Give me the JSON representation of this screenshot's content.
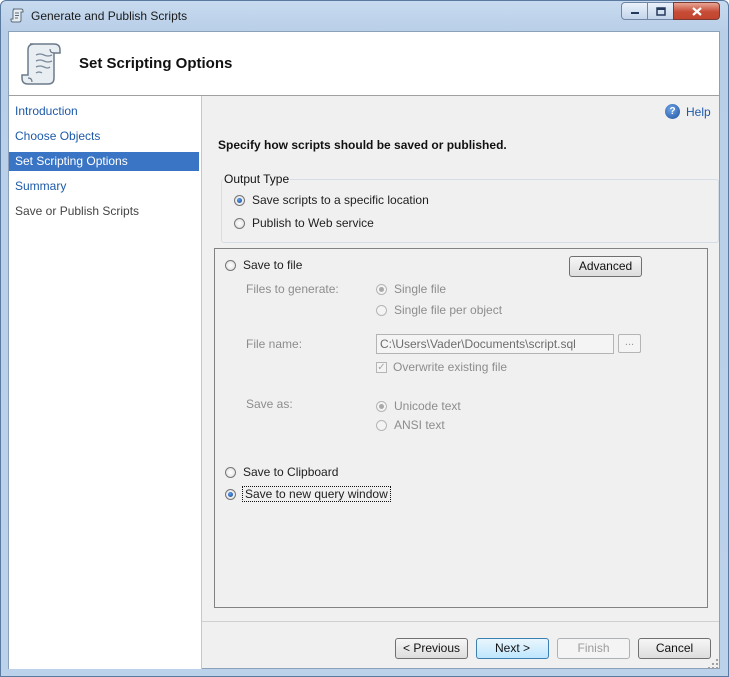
{
  "window": {
    "title": "Generate and Publish Scripts"
  },
  "header": {
    "title": "Set Scripting Options"
  },
  "nav": {
    "items": [
      {
        "label": "Introduction",
        "state": "link"
      },
      {
        "label": "Choose Objects",
        "state": "link"
      },
      {
        "label": "Set Scripting Options",
        "state": "selected"
      },
      {
        "label": "Summary",
        "state": "link"
      },
      {
        "label": "Save or Publish Scripts",
        "state": "disabled"
      }
    ]
  },
  "help": {
    "label": "Help"
  },
  "main": {
    "instruction": "Specify how scripts should be saved or published.",
    "output_type": {
      "label": "Output Type",
      "options": [
        {
          "label": "Save scripts to a specific location",
          "checked": true
        },
        {
          "label": "Publish to Web service",
          "checked": false
        }
      ]
    },
    "save_to_file": {
      "label": "Save to file",
      "checked": false
    },
    "advanced_label": "Advanced",
    "files_to_generate": {
      "label": "Files to generate:",
      "options": [
        {
          "label": "Single file",
          "checked": true
        },
        {
          "label": "Single file per object",
          "checked": false
        }
      ]
    },
    "file_name": {
      "label": "File name:",
      "value": "C:\\Users\\Vader\\Documents\\script.sql",
      "browse_label": "..."
    },
    "overwrite": {
      "label": "Overwrite existing file",
      "checked": true
    },
    "save_as": {
      "label": "Save as:",
      "options": [
        {
          "label": "Unicode text",
          "checked": true
        },
        {
          "label": "ANSI text",
          "checked": false
        }
      ]
    },
    "save_to_clipboard": {
      "label": "Save to Clipboard",
      "checked": false
    },
    "save_to_query": {
      "label": "Save to new query window",
      "checked": true
    }
  },
  "footer": {
    "previous_label": "< Previous",
    "next_label": "Next >",
    "finish_label": "Finish",
    "cancel_label": "Cancel"
  },
  "colors": {
    "accent": "#3a74c4",
    "link": "#1d5aa8"
  }
}
